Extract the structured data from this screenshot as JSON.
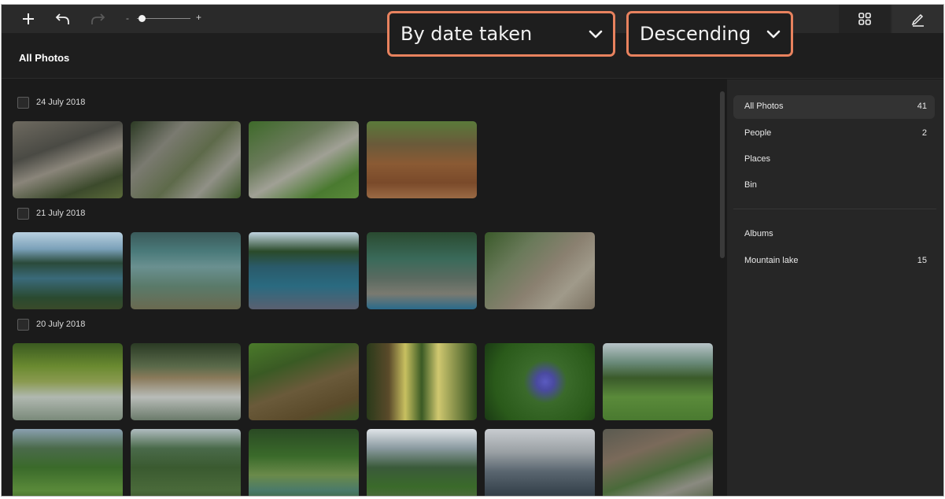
{
  "toolbar": {
    "add_icon": "plus-icon",
    "undo_icon": "undo-icon",
    "redo_icon": "redo-icon",
    "zoom_minus": "-",
    "zoom_plus": "+",
    "zoom_level": 0.1,
    "grid_icon": "grid-view-icon",
    "edit_icon": "pencil-icon"
  },
  "header": {
    "title": "All Photos",
    "sort_by": "By date taken",
    "sort_order": "Descending",
    "highlight_color": "#e8825e"
  },
  "groups": [
    {
      "date": "24 July 2018",
      "photo_count": 4
    },
    {
      "date": "21 July 2018",
      "photo_count": 5
    },
    {
      "date": "20 July 2018",
      "photo_count": 12
    }
  ],
  "sidebar": {
    "items": [
      {
        "label": "All Photos",
        "count": "41",
        "active": true
      },
      {
        "label": "People",
        "count": "2"
      },
      {
        "label": "Places",
        "count": ""
      },
      {
        "label": "Bin",
        "count": ""
      }
    ],
    "albums_label": "Albums",
    "albums": [
      {
        "label": "Mountain lake",
        "count": "15"
      }
    ]
  }
}
